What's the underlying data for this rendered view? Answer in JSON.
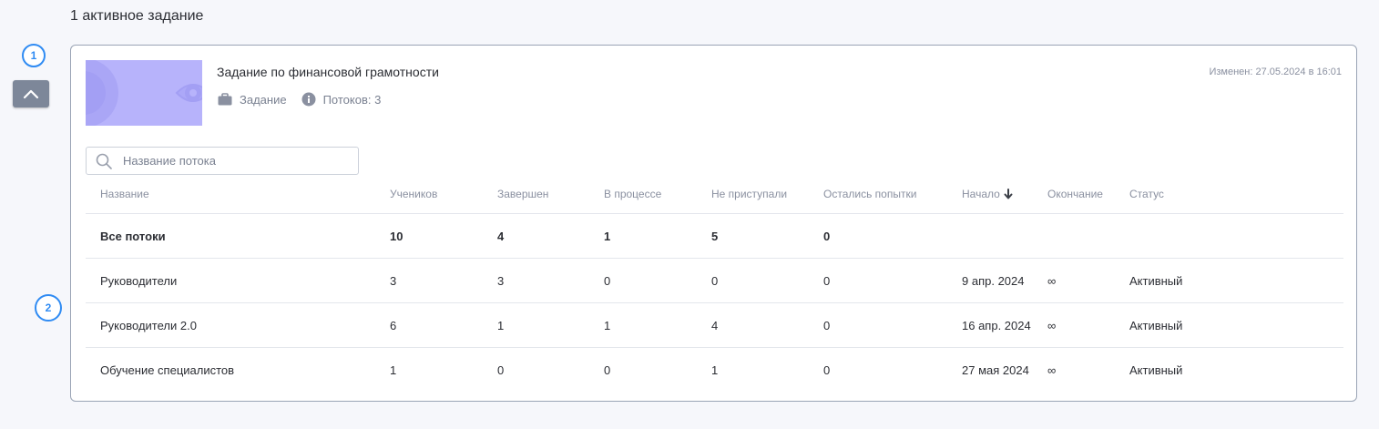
{
  "header": {
    "title": "1 активное задание"
  },
  "markers": [
    "1",
    "2"
  ],
  "task": {
    "title": "Задание по финансовой грамотности",
    "type_label": "Задание",
    "streams_label": "Потоков: 3",
    "modified": "Изменен: 27.05.2024 в 16:01"
  },
  "search": {
    "placeholder": "Название потока",
    "value": ""
  },
  "table": {
    "columns": {
      "name": "Название",
      "students": "Учеников",
      "completed": "Завершен",
      "in_progress": "В процессе",
      "not_started": "Не приступали",
      "attempts_left": "Остались попытки",
      "start": "Начало",
      "end": "Окончание",
      "status": "Статус"
    },
    "sort": {
      "column": "start",
      "direction": "desc"
    },
    "rows": [
      {
        "name": "Все потоки",
        "students": "10",
        "completed": "4",
        "in_progress": "1",
        "not_started": "5",
        "attempts_left": "0",
        "start": "",
        "end": "",
        "status": ""
      },
      {
        "name": "Руководители",
        "students": "3",
        "completed": "3",
        "in_progress": "0",
        "not_started": "0",
        "attempts_left": "0",
        "start": "9 апр. 2024",
        "end": "∞",
        "status": "Активный"
      },
      {
        "name": "Руководители 2.0",
        "students": "6",
        "completed": "1",
        "in_progress": "1",
        "not_started": "4",
        "attempts_left": "0",
        "start": "16 апр. 2024",
        "end": "∞",
        "status": "Активный"
      },
      {
        "name": "Обучение специалистов",
        "students": "1",
        "completed": "0",
        "in_progress": "0",
        "not_started": "1",
        "attempts_left": "0",
        "start": "27 мая 2024",
        "end": "∞",
        "status": "Активный"
      }
    ]
  },
  "colors": {
    "accent": "#2f8bf3",
    "thumbnail": "#b7b3fb",
    "collapse_button": "#7d8799"
  },
  "icons": {
    "collapse": "chevron-up-icon",
    "type": "briefcase-icon",
    "streams": "info-icon",
    "search": "search-icon",
    "sort": "arrow-down-icon"
  }
}
